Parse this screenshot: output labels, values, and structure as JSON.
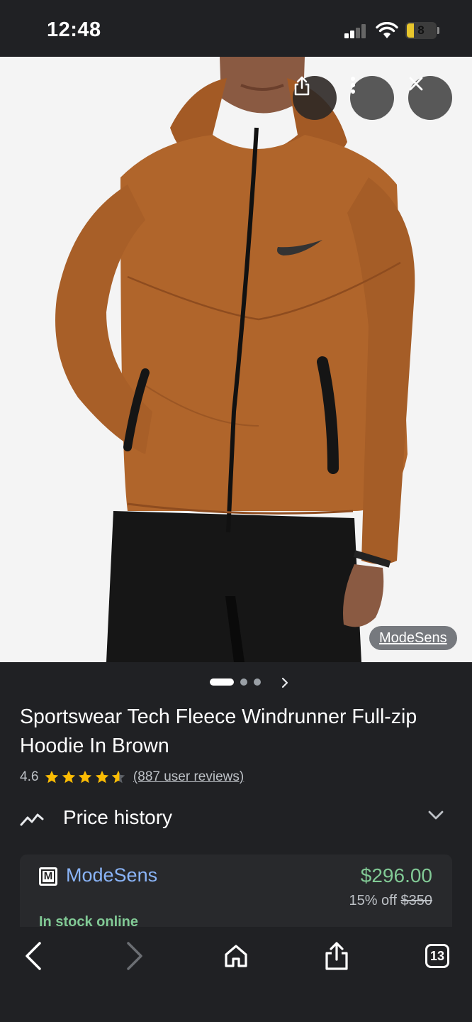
{
  "status_bar": {
    "time": "12:48",
    "battery_level": "8"
  },
  "image": {
    "source_label": "ModeSens",
    "carousel_dots": 3,
    "active_dot": 0
  },
  "product": {
    "title": "Sportswear Tech Fleece Windrunner Full-zip Hoodie In Brown",
    "rating": "4.6",
    "stars": 4.6,
    "reviews_label": "(887 user reviews)"
  },
  "price_history": {
    "label": "Price history"
  },
  "offer": {
    "merchant": "ModeSens",
    "merchant_logo_letter": "M",
    "price": "$296.00",
    "discount": "15% off",
    "original_price": "$350",
    "stock": "In stock online"
  },
  "toolbar": {
    "tab_count": "13"
  },
  "colors": {
    "background": "#202124",
    "link_blue": "#8ab4f8",
    "price_green": "#81c995",
    "star_yellow": "#fbbc04"
  },
  "icons": [
    "share-icon",
    "more-vert-icon",
    "close-icon",
    "chevron-right-icon",
    "trending-icon",
    "chevron-down-icon",
    "back-icon",
    "forward-icon",
    "home-icon",
    "tabs-icon"
  ]
}
